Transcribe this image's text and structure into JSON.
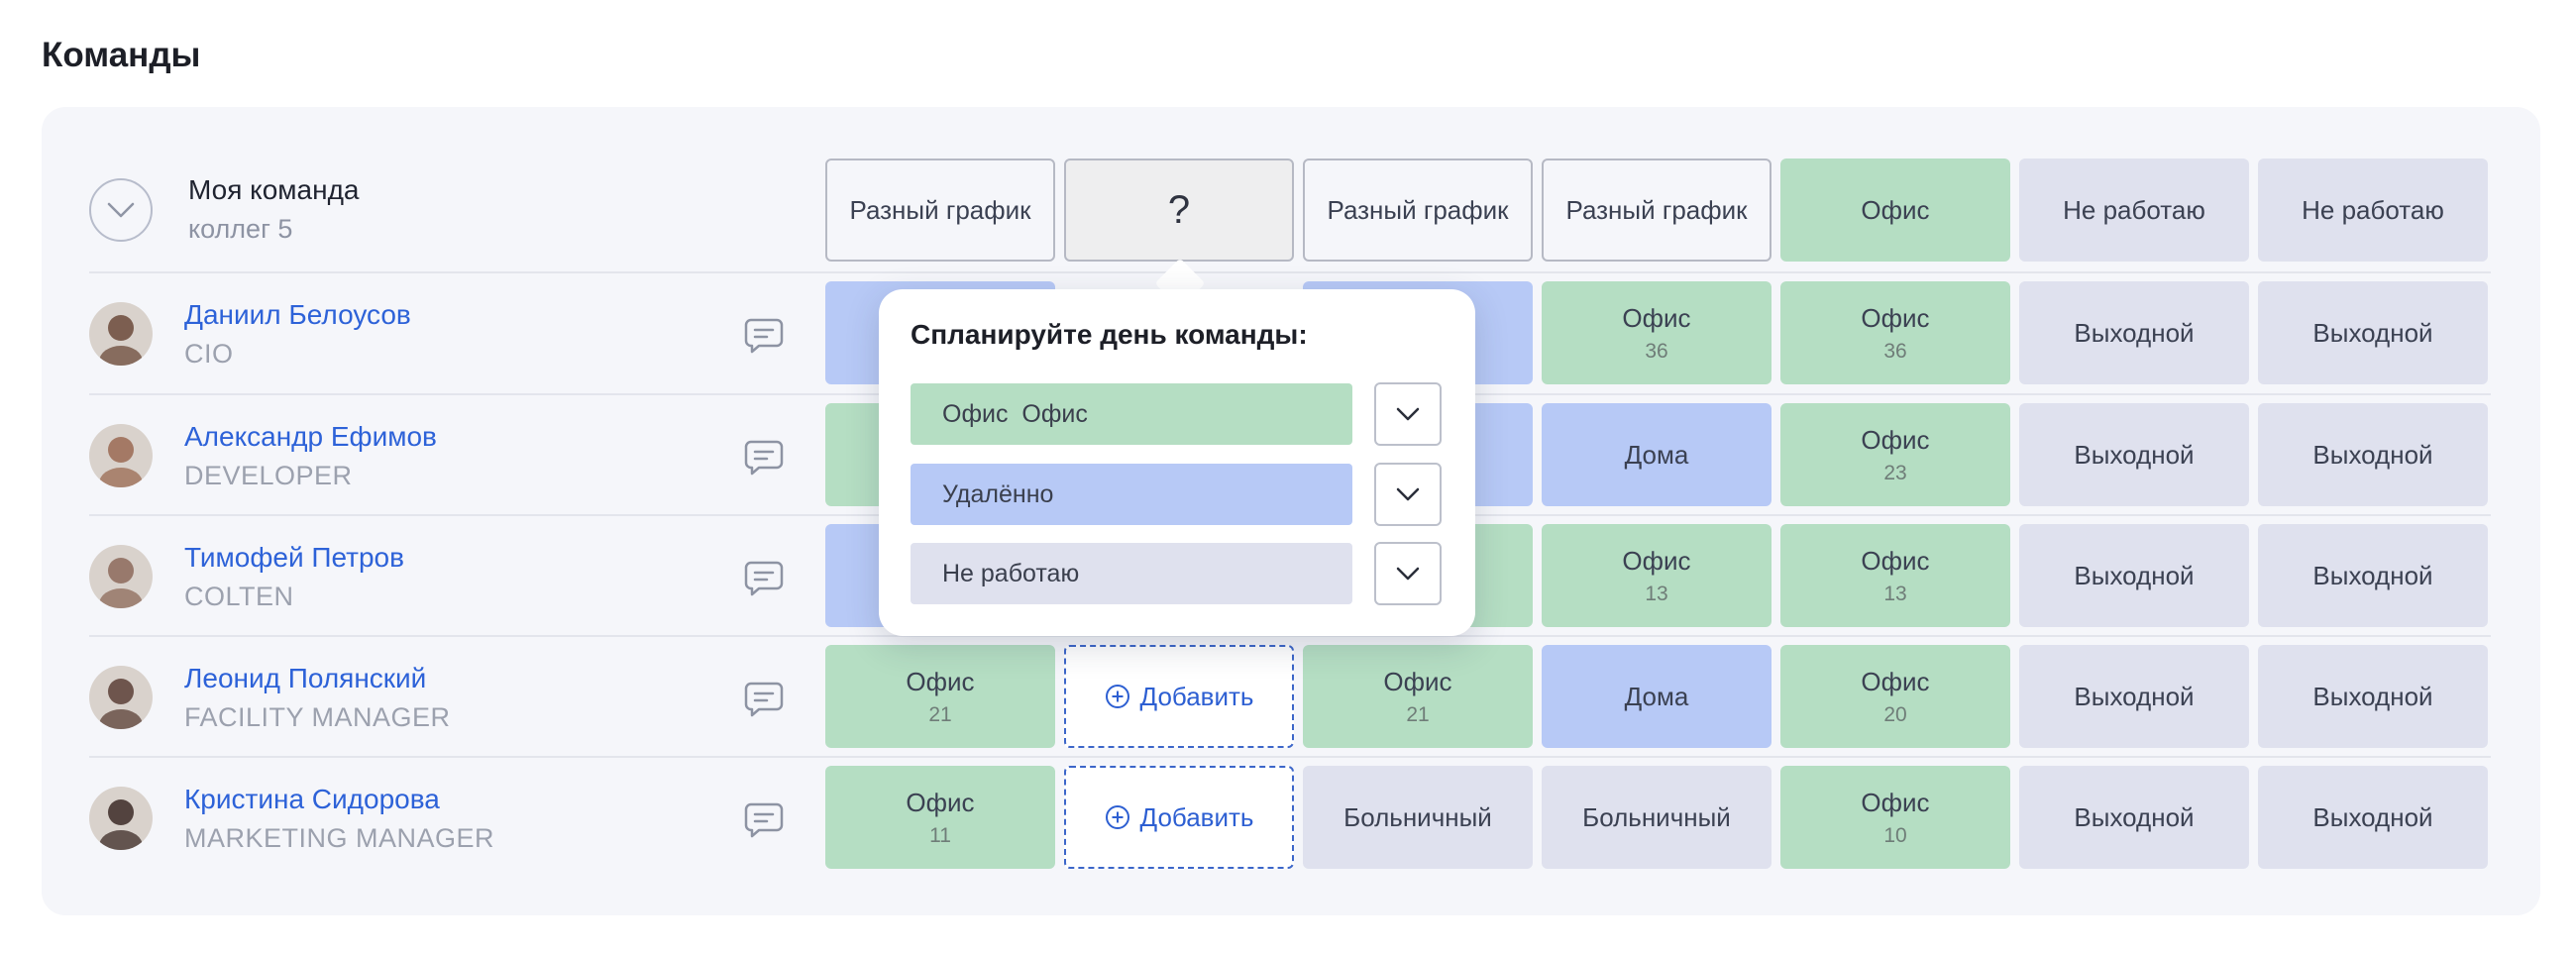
{
  "page_title": "Команды",
  "team": {
    "name": "Моя команда",
    "count": "коллег 5"
  },
  "colors": {
    "office": "#b5dec3",
    "home": "#b7c9f6",
    "off": "#dfe1ee",
    "link": "#2d62d8",
    "accent": "#3c66c9"
  },
  "header_days": [
    {
      "label": "Разный график",
      "type": "var"
    },
    {
      "label": "?",
      "type": "q"
    },
    {
      "label": "Разный график",
      "type": "var"
    },
    {
      "label": "Разный график",
      "type": "var"
    },
    {
      "label": "Офис",
      "type": "office"
    },
    {
      "label": "Не работаю",
      "type": "off"
    },
    {
      "label": "Не работаю",
      "type": "off"
    }
  ],
  "people": [
    {
      "name": "Даниил Белоусов",
      "role": "CIO",
      "avatar": "avatar-photo",
      "days": [
        {
          "type": "home",
          "label": ""
        },
        {
          "type": "hidden",
          "label": ""
        },
        {
          "type": "home",
          "label": ""
        },
        {
          "type": "office",
          "label": "Офис",
          "num": "36"
        },
        {
          "type": "office",
          "label": "Офис",
          "num": "36"
        },
        {
          "type": "off",
          "label": "Выходной"
        },
        {
          "type": "off",
          "label": "Выходной"
        }
      ]
    },
    {
      "name": "Александр Ефимов",
      "role": "DEVELOPER",
      "avatar": "avatar-photo",
      "days": [
        {
          "type": "office",
          "label": ""
        },
        {
          "type": "hidden",
          "label": ""
        },
        {
          "type": "home",
          "label": ""
        },
        {
          "type": "home",
          "label": "Дома"
        },
        {
          "type": "office",
          "label": "Офис",
          "num": "23"
        },
        {
          "type": "off",
          "label": "Выходной"
        },
        {
          "type": "off",
          "label": "Выходной"
        }
      ]
    },
    {
      "name": "Тимофей Петров",
      "role": "COLTEN",
      "avatar": "avatar-photo",
      "days": [
        {
          "type": "home",
          "label": ""
        },
        {
          "type": "hidden",
          "label": ""
        },
        {
          "type": "office",
          "label": ""
        },
        {
          "type": "office",
          "label": "Офис",
          "num": "13"
        },
        {
          "type": "office",
          "label": "Офис",
          "num": "13"
        },
        {
          "type": "off",
          "label": "Выходной"
        },
        {
          "type": "off",
          "label": "Выходной"
        }
      ]
    },
    {
      "name": "Леонид Полянский",
      "role": "FACILITY MANAGER",
      "avatar": "avatar-photo",
      "days": [
        {
          "type": "office",
          "label": "Офис",
          "num": "21"
        },
        {
          "type": "add",
          "label": "Добавить"
        },
        {
          "type": "office",
          "label": "Офис",
          "num": "21"
        },
        {
          "type": "home",
          "label": "Дома"
        },
        {
          "type": "office",
          "label": "Офис",
          "num": "20"
        },
        {
          "type": "off",
          "label": "Выходной"
        },
        {
          "type": "off",
          "label": "Выходной"
        }
      ]
    },
    {
      "name": "Кристина Сидорова",
      "role": "MARKETING MANAGER",
      "avatar": "avatar-photo",
      "days": [
        {
          "type": "office",
          "label": "Офис",
          "num": "11"
        },
        {
          "type": "add",
          "label": "Добавить"
        },
        {
          "type": "off",
          "label": "Больничный"
        },
        {
          "type": "off",
          "label": "Больничный"
        },
        {
          "type": "office",
          "label": "Офис",
          "num": "10"
        },
        {
          "type": "off",
          "label": "Выходной"
        },
        {
          "type": "off",
          "label": "Выходной"
        }
      ]
    }
  ],
  "popup": {
    "title": "Спланируйте день команды:",
    "options": [
      {
        "label": "Офис  Офис",
        "type": "office",
        "icon": "chevron-down-icon"
      },
      {
        "label": "Удалённо",
        "type": "home",
        "icon": "chevron-down-icon"
      },
      {
        "label": "Не работаю",
        "type": "off",
        "icon": "chevron-down-icon"
      }
    ]
  }
}
